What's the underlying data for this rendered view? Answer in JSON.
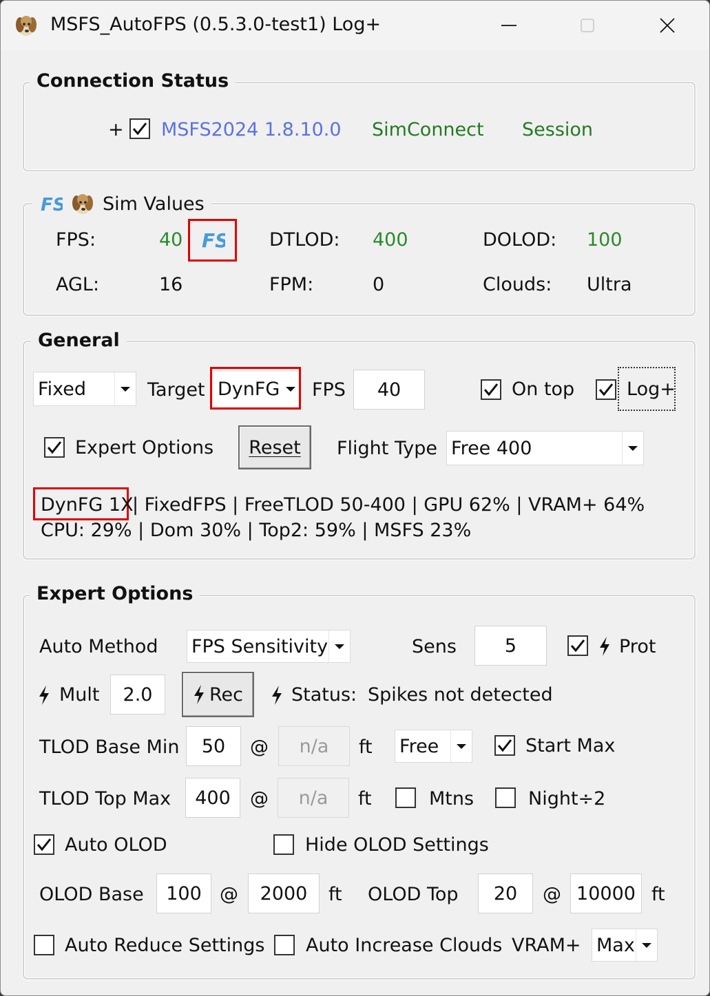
{
  "window": {
    "title": "MSFS_AutoFPS (0.5.3.0-test1) Log+",
    "icon": "dog-icon"
  },
  "connection": {
    "group_label": "Connection Status",
    "plus": "+",
    "sim_checked": true,
    "sim_version": "MSFS2024 1.8.10.0",
    "simconnect": "SimConnect",
    "session": "Session"
  },
  "sim_values": {
    "group_label": "Sim Values",
    "fps_label": "FPS:",
    "fps_value": "40",
    "dtlod_label": "DTLOD:",
    "dtlod_value": "400",
    "dolod_label": "DOLOD:",
    "dolod_value": "100",
    "agl_label": "AGL:",
    "agl_value": "16",
    "fpm_label": "FPM:",
    "fpm_value": "0",
    "clouds_label": "Clouds:",
    "clouds_value": "Ultra"
  },
  "general": {
    "group_label": "General",
    "mode_value": "Fixed",
    "target_label": "Target",
    "target_value": "DynFG",
    "fps_label": "FPS",
    "fps_value": "40",
    "on_top_label": "On top",
    "on_top_checked": true,
    "log_label": "Log+",
    "log_checked": true,
    "expert_label": "Expert Options",
    "expert_checked": true,
    "reset_label": "Reset",
    "flight_type_label": "Flight Type",
    "flight_type_value": "Free 400",
    "status_dynfg": "DynFG 1X",
    "status_line1_rest": "| FixedFPS | FreeTLOD 50-400 | GPU 62% | VRAM+ 64%",
    "status_line2": "CPU: 29% | Dom 30% | Top2: 59% | MSFS 23%"
  },
  "expert": {
    "group_label": "Expert Options",
    "auto_method_label": "Auto Method",
    "auto_method_value": "FPS Sensitivity",
    "sens_label": "Sens",
    "sens_value": "5",
    "prot_label": "Prot",
    "prot_checked": true,
    "mult_label": "Mult",
    "mult_value": "2.0",
    "rec_label": "Rec",
    "status_label": "Status:",
    "status_value": "Spikes not detected",
    "tlod_base_min_label": "TLOD Base Min",
    "tlod_base_min_value": "50",
    "at": "@",
    "na": "n/a",
    "ft": "ft",
    "tlod_base_mode": "Free",
    "start_max_label": "Start Max",
    "start_max_checked": true,
    "tlod_top_max_label": "TLOD Top Max",
    "tlod_top_max_value": "400",
    "mtns_label": "Mtns",
    "mtns_checked": false,
    "night_label": "Night÷2",
    "night_checked": false,
    "auto_olod_label": "Auto OLOD",
    "auto_olod_checked": true,
    "hide_olod_label": "Hide OLOD Settings",
    "hide_olod_checked": false,
    "olod_base_label": "OLOD Base",
    "olod_base_value": "100",
    "olod_base_alt": "2000",
    "olod_top_label": "OLOD Top",
    "olod_top_value": "20",
    "olod_top_alt": "10000",
    "auto_reduce_label": "Auto Reduce Settings",
    "auto_reduce_checked": false,
    "auto_increase_label": "Auto Increase Clouds",
    "auto_increase_checked": false,
    "vram_label": "VRAM+",
    "vram_value": "Max"
  },
  "colors": {
    "highlight_box": "#e00000",
    "green_value": "#2a8a2a",
    "blue_version": "#5b72e0"
  }
}
